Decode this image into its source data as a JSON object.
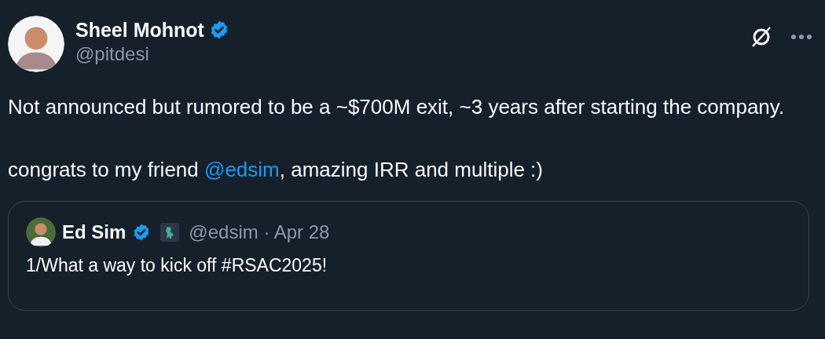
{
  "author": {
    "name": "Sheel Mohnot",
    "handle": "@pitdesi",
    "verified": true
  },
  "body": [
    {
      "parts": [
        {
          "kind": "text",
          "text": "Not announced but rumored to be a ~$700M exit, ~3 years after starting the company."
        }
      ]
    },
    {
      "parts": [
        {
          "kind": "text",
          "text": "congrats to my friend "
        },
        {
          "kind": "mention",
          "text": "@edsim"
        },
        {
          "kind": "text",
          "text": ", amazing IRR and multiple :)"
        }
      ]
    }
  ],
  "quoted_post": {
    "author": {
      "name": "Ed Sim",
      "verified": true,
      "handle_date": "@edsim · Apr 28"
    },
    "text": "1/What a way to kick off #RSAC2025!"
  }
}
